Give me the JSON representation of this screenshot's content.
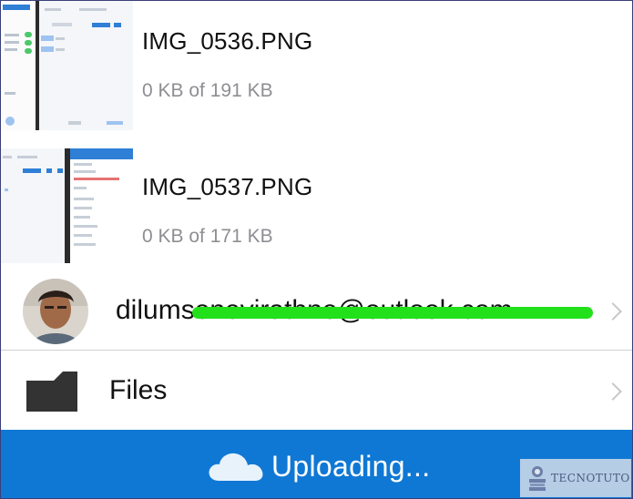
{
  "files": [
    {
      "name": "IMG_0536.PNG",
      "progress": "0 KB of 191 KB"
    },
    {
      "name": "IMG_0537.PNG",
      "progress": "0 KB of 171 KB"
    }
  ],
  "account": {
    "email": "dilumsenevirathne@outlook.com",
    "avatar_icon": "user-avatar"
  },
  "files_entry": {
    "label": "Files",
    "icon": "folder-icon"
  },
  "status_bar": {
    "text": "Uploading...",
    "icon": "cloud-icon",
    "color": "#0f78d4"
  },
  "watermark": {
    "text": "TECNOTUTO"
  },
  "colors": {
    "redaction": "#22e01a",
    "secondary_text": "#8e8e93",
    "chevron": "#c7c7cc"
  }
}
